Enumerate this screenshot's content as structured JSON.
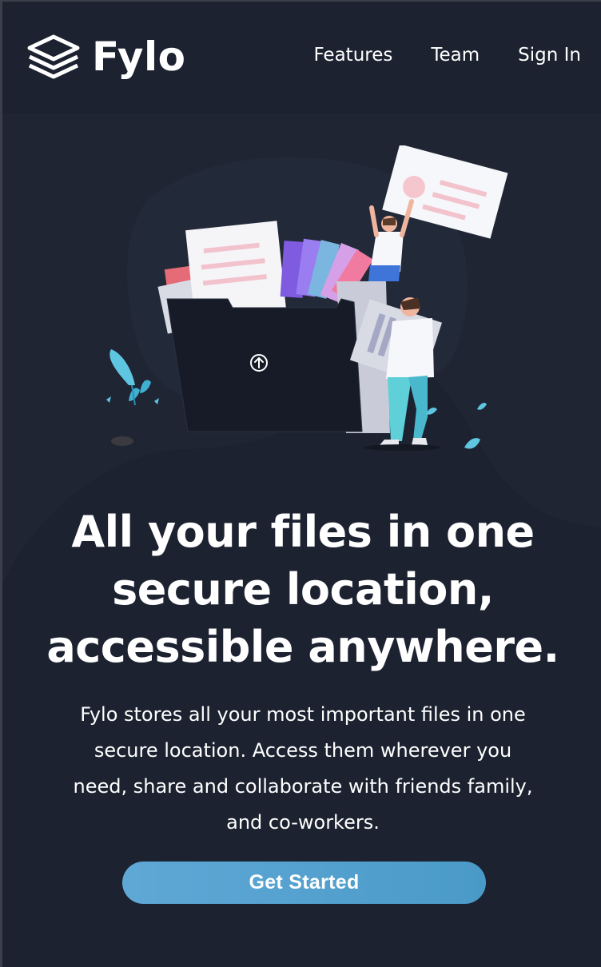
{
  "app": {
    "name": "Fylo"
  },
  "nav": {
    "links": [
      {
        "label": "Features"
      },
      {
        "label": "Team"
      },
      {
        "label": "Sign In"
      }
    ]
  },
  "hero": {
    "title_lines": [
      "All your files in one",
      "secure location,",
      "accessible anywhere."
    ],
    "description_lines": [
      "Fylo stores all your most important files in one",
      "secure location. Access them wherever you",
      "need, share and collaborate with friends family,",
      "and co-workers."
    ],
    "cta_label": "Get Started"
  },
  "colors": {
    "background": "#1c2230",
    "accent_blue": "#4a9ac8",
    "accent_teal": "#65d9e4",
    "accent_pink": "#f4a3b4"
  },
  "icons": {
    "logo": "stacked-layers-icon",
    "upload": "upload-arrow-icon"
  }
}
